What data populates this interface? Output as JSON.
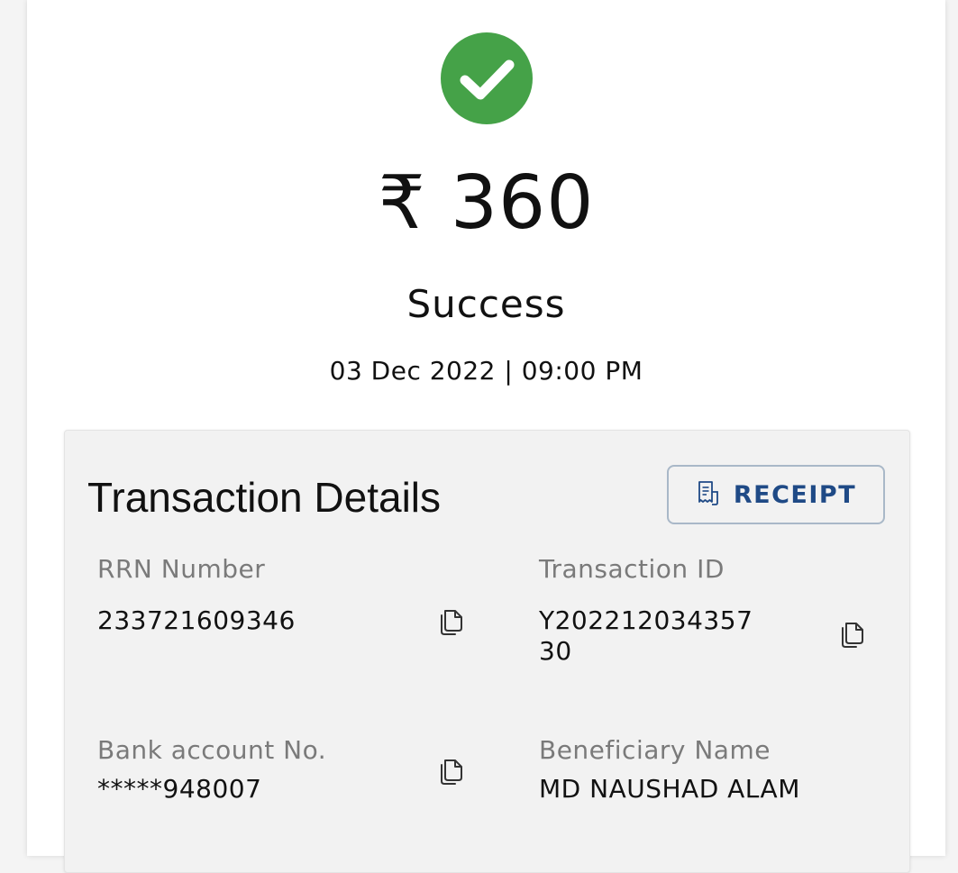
{
  "payment": {
    "amount": "₹ 360",
    "status": "Success",
    "datetime": "03 Dec 2022 | 09:00 PM"
  },
  "details": {
    "title": "Transaction Details",
    "receipt_label": "RECEIPT",
    "rrn_label": "RRN Number",
    "rrn_value": "233721609346",
    "txn_label": "Transaction ID",
    "txn_value_line1": "Y202212034357",
    "txn_value_line2": "30",
    "bank_label": "Bank account No.",
    "bank_value": "*****948007",
    "beneficiary_label": "Beneficiary Name",
    "beneficiary_value": "MD NAUSHAD ALAM"
  },
  "icons": {
    "status": "check-circle-icon",
    "receipt": "receipt-icon",
    "copy": "copy-icon"
  },
  "colors": {
    "success": "#45a248",
    "receipt_text": "#1f4a86",
    "receipt_border": "#a9b8c8",
    "label_gray": "#7a7a7a"
  }
}
